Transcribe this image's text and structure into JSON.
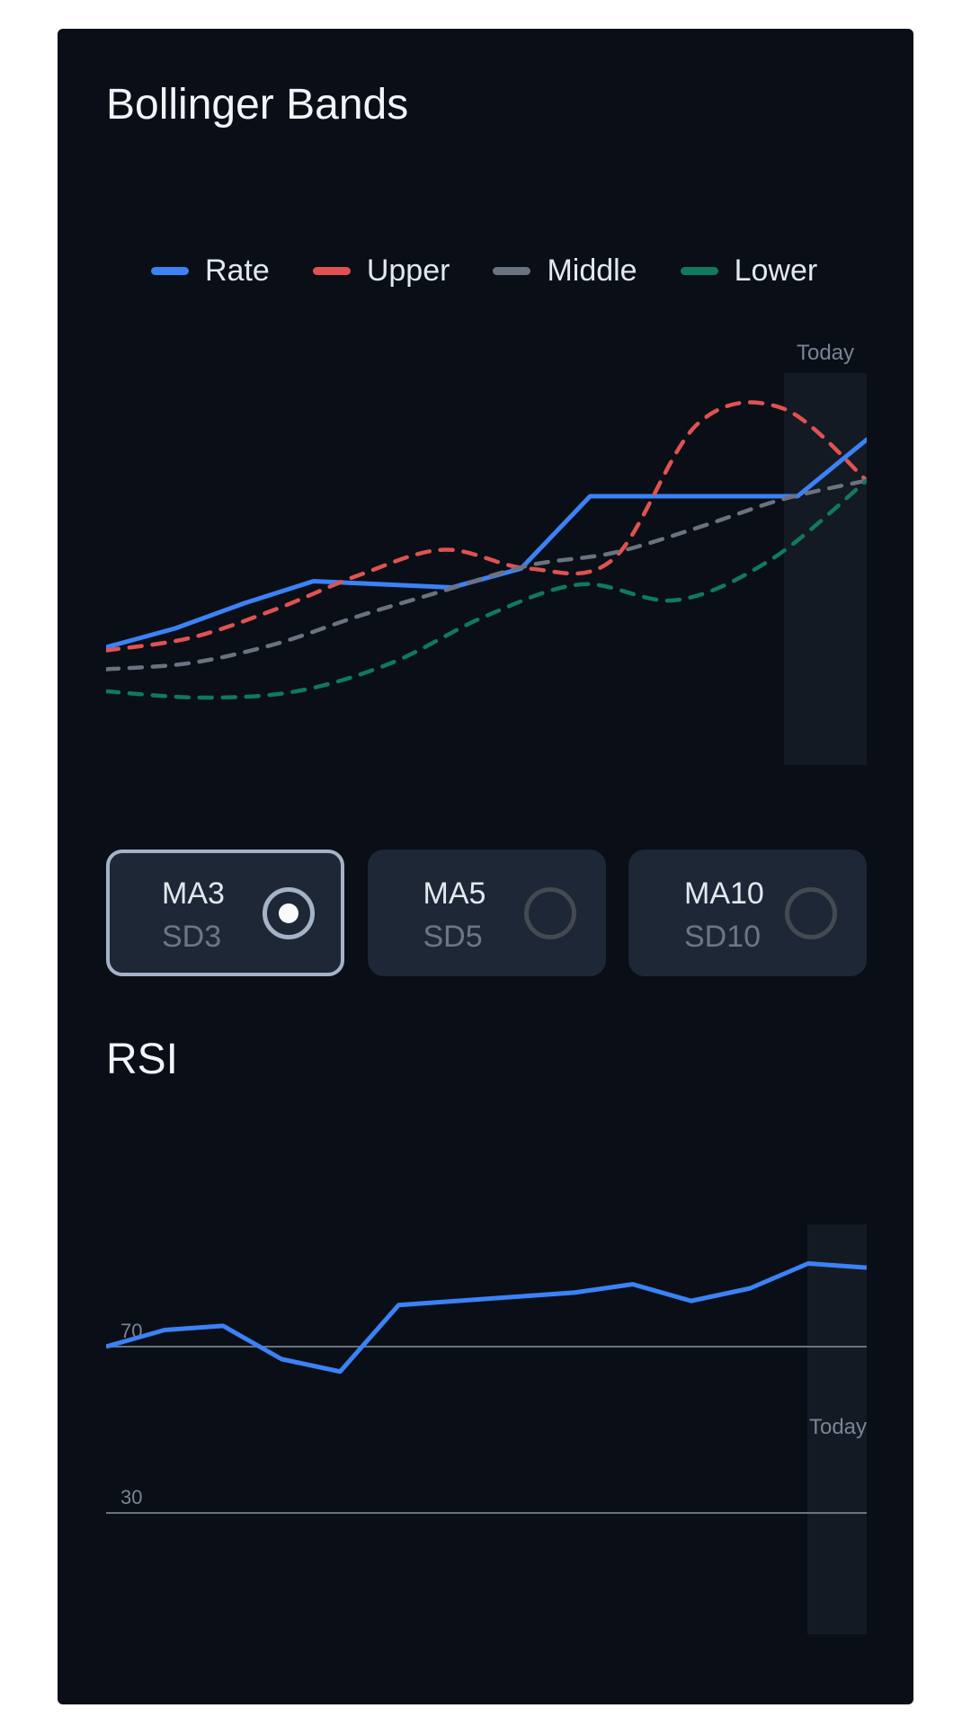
{
  "bollinger": {
    "title": "Bollinger Bands",
    "legend": [
      {
        "label": "Rate",
        "color": "#3b82f6"
      },
      {
        "label": "Upper",
        "color": "#e05252"
      },
      {
        "label": "Middle",
        "color": "#6b7280"
      },
      {
        "label": "Lower",
        "color": "#0f7a5c"
      }
    ],
    "today_label": "Today"
  },
  "periods": [
    {
      "ma": "MA3",
      "sd": "SD3",
      "selected": true
    },
    {
      "ma": "MA5",
      "sd": "SD5",
      "selected": false
    },
    {
      "ma": "MA10",
      "sd": "SD10",
      "selected": false
    }
  ],
  "rsi": {
    "title": "RSI",
    "today_label": "Today",
    "line_color": "#3b82f6"
  },
  "chart_data": [
    {
      "type": "line",
      "title": "Bollinger Bands",
      "x": [
        0,
        1,
        2,
        3,
        4,
        5,
        6,
        7,
        8,
        9,
        10,
        11,
        12,
        13,
        14
      ],
      "ylim": [
        0,
        100
      ],
      "legend_position": "top",
      "grid": false,
      "highlight_last_point_label": "Today",
      "series": [
        {
          "name": "Rate",
          "color": "#3b82f6",
          "style": "solid",
          "values": [
            32,
            38,
            46,
            53,
            52,
            51,
            57,
            80,
            80,
            80,
            80,
            98
          ]
        },
        {
          "name": "Upper",
          "color": "#e05252",
          "style": "dashed",
          "values": [
            31,
            35,
            44,
            55,
            63,
            57,
            60,
            103,
            108,
            85
          ]
        },
        {
          "name": "Middle",
          "color": "#6b7280",
          "style": "dashed",
          "values": [
            25,
            27,
            33,
            42,
            50,
            58,
            62,
            70,
            79,
            85
          ]
        },
        {
          "name": "Lower",
          "color": "#0f7a5c",
          "style": "dashed",
          "values": [
            18,
            16,
            18,
            27,
            42,
            52,
            47,
            60,
            85
          ]
        }
      ]
    },
    {
      "type": "line",
      "title": "RSI",
      "x": [
        0,
        1,
        2,
        3,
        4,
        5,
        6,
        7,
        8,
        9,
        10,
        11,
        12,
        13
      ],
      "ylim": [
        0,
        100
      ],
      "reference_lines": [
        70,
        30
      ],
      "reference_labels": [
        "70",
        "30"
      ],
      "highlight_last_point_label": "Today",
      "series": [
        {
          "name": "",
          "color": "#3b82f6",
          "values": [
            70,
            74,
            75,
            67,
            64,
            80,
            81,
            82,
            83,
            85,
            81,
            84,
            90,
            89
          ]
        }
      ]
    }
  ]
}
